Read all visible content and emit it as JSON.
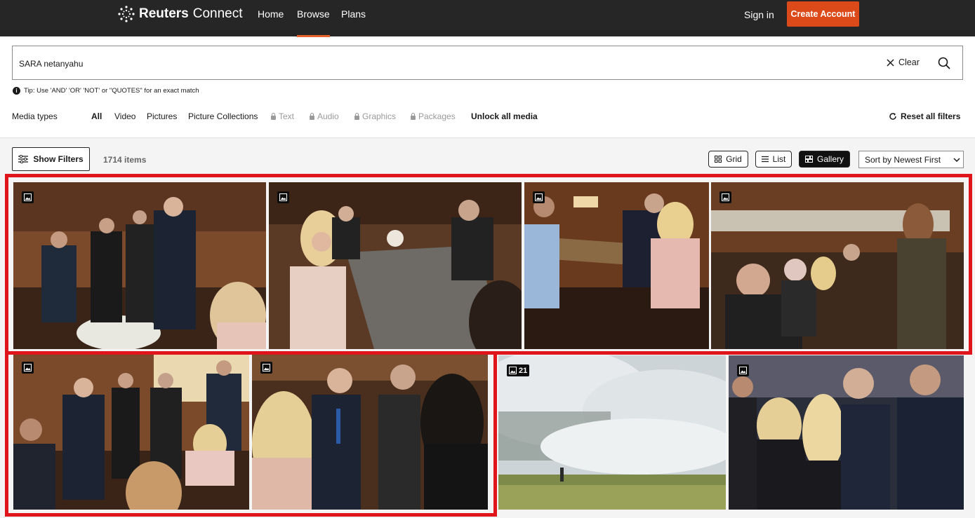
{
  "nav": {
    "brand_main": "Reuters",
    "brand_sub": "Connect",
    "links": [
      "Home",
      "Browse",
      "Plans"
    ],
    "active_link": "Browse",
    "signin": "Sign in",
    "create_account": "Create Account"
  },
  "search": {
    "value": "SARA netanyahu",
    "clear_label": "Clear",
    "tip": "Tip: Use 'AND' 'OR' 'NOT' or \"QUOTES\" for an exact match"
  },
  "media_types": {
    "label": "Media types",
    "items": [
      "All",
      "Video",
      "Pictures",
      "Picture Collections",
      "Text",
      "Audio",
      "Graphics",
      "Packages",
      "Unlock all media"
    ],
    "active": "All",
    "locked": [
      "Text",
      "Audio",
      "Graphics",
      "Packages"
    ],
    "reset_label": "Reset all filters"
  },
  "toolbar": {
    "show_filters": "Show Filters",
    "count": "1714 items",
    "views": [
      "Grid",
      "List",
      "Gallery"
    ],
    "active_view": "Gallery",
    "sort": "Sort by Newest First"
  },
  "gallery": {
    "collection_count": "21",
    "highlight_color": "#e0151b"
  },
  "colors": {
    "nav_bg": "#262626",
    "accent": "#dc4a19"
  }
}
